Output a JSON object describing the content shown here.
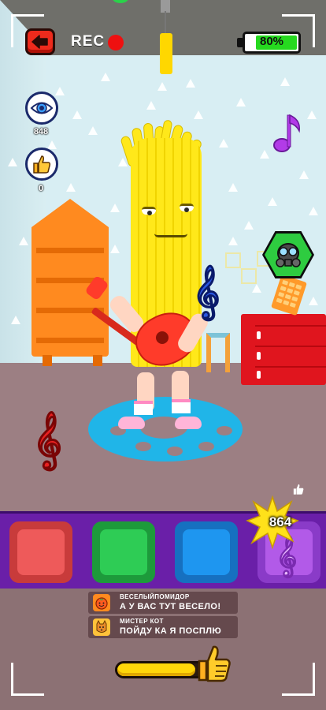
{
  "hud": {
    "rec_label": "REC",
    "battery_label": "80%",
    "battery_level": 0.8,
    "colors": {
      "rec_dot": "#ee1010",
      "battery_fill": "#26d91f",
      "back_button": "#ee2a1c"
    }
  },
  "stats": {
    "views_icon": "eye-icon",
    "views": "848",
    "likes_icon": "thumbs-up-icon",
    "likes": "0"
  },
  "scene": {
    "character": "fries-stick-character-with-guitar",
    "badge_icon": "gas-mask-icon",
    "notes": [
      "music-note-icon",
      "treble-clef-icon",
      "treble-clef-icon"
    ]
  },
  "pads": [
    {
      "name": "red",
      "color": "#ee5a5a",
      "border": "#c83b3b"
    },
    {
      "name": "green",
      "color": "#2ecc55",
      "border": "#1d9a3b"
    },
    {
      "name": "blue",
      "color": "#1e96f0",
      "border": "#1670c0"
    },
    {
      "name": "purple",
      "color": "#b25ae8",
      "border": "#8a3bc8",
      "icon": "treble-clef-icon"
    }
  ],
  "score": {
    "counter": "864"
  },
  "chat": [
    {
      "name": "ВЕСЕЛЫЙПОМИДОР",
      "message": "А У ВАС ТУТ ВЕСЕЛО!",
      "avatar": "tomato-avatar"
    },
    {
      "name": "МИСТЕР КОТ",
      "message": "ПОЙДУ КА Я ПОСПЛЮ",
      "avatar": "cat-avatar"
    }
  ],
  "like_meter": {
    "level": 0.88,
    "icon": "thumbs-up-icon"
  }
}
